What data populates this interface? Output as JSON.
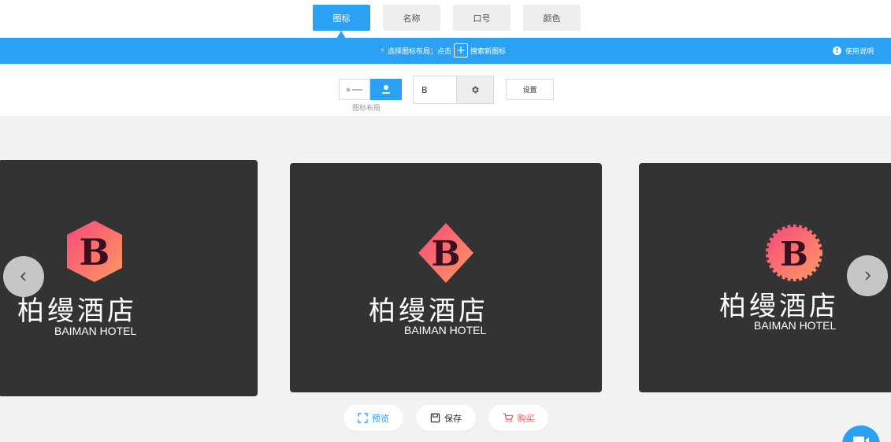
{
  "tabs": [
    {
      "label": "图标",
      "active": true
    },
    {
      "label": "名称",
      "active": false
    },
    {
      "label": "口号",
      "active": false
    },
    {
      "label": "颜色",
      "active": false
    }
  ],
  "infobar": {
    "hint_prefix": "选择图标布局；点击",
    "hint_suffix": "搜索新图标",
    "help_label": "使用说明"
  },
  "controls": {
    "layout_label": "图标布局",
    "letter_value": "B",
    "settings_label": "设置"
  },
  "cards": [
    {
      "emblem_shape": "hexagon",
      "emblem_letter": "B",
      "name_cn": "柏缦酒店",
      "name_en": "BAIMAN HOTEL"
    },
    {
      "emblem_shape": "diamond",
      "emblem_letter": "B",
      "name_cn": "柏缦酒店",
      "name_en": "BAIMAN HOTEL"
    },
    {
      "emblem_shape": "scalloped-circle",
      "emblem_letter": "B",
      "name_cn": "柏缦酒店",
      "name_en": "BAIMAN HOTEL"
    }
  ],
  "actions": {
    "preview_label": "预览",
    "save_label": "保存",
    "buy_label": "购买"
  },
  "colors": {
    "accent": "#2aa1f2",
    "card_bg": "#333333",
    "emblem_gradient_start": "#f7497a",
    "emblem_gradient_end": "#fd9a62",
    "buy": "#f05a5a"
  }
}
